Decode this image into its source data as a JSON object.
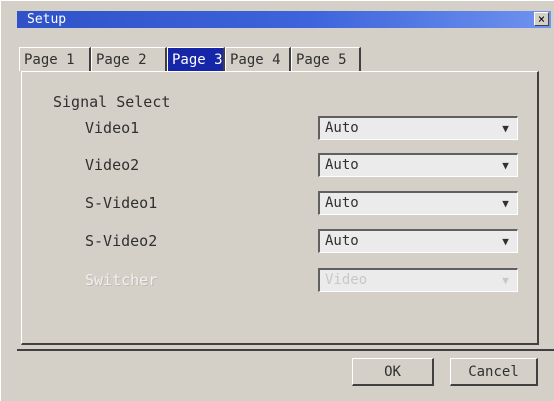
{
  "window": {
    "title": "Setup",
    "close_label": "×"
  },
  "tabs": [
    {
      "label": "Page 1",
      "active": false
    },
    {
      "label": "Page 2",
      "active": false
    },
    {
      "label": "Page 3",
      "active": true
    },
    {
      "label": "Page 4",
      "active": false
    },
    {
      "label": "Page 5",
      "active": false
    }
  ],
  "signal_select": {
    "group_label": "Signal Select",
    "rows": [
      {
        "label": "Video1",
        "value": "Auto",
        "enabled": true
      },
      {
        "label": "Video2",
        "value": "Auto",
        "enabled": true
      },
      {
        "label": "S-Video1",
        "value": "Auto",
        "enabled": true
      },
      {
        "label": "S-Video2",
        "value": "Auto",
        "enabled": true
      },
      {
        "label": "Switcher",
        "value": "Video",
        "enabled": false
      }
    ]
  },
  "buttons": {
    "ok": "OK",
    "cancel": "Cancel"
  },
  "icons": {
    "dropdown": "dropdown-arrow-icon",
    "close": "close-icon"
  },
  "colors": {
    "title_bar": "#2f52c8",
    "active_tab": "#1626a8",
    "face": "#d4d0c8"
  }
}
